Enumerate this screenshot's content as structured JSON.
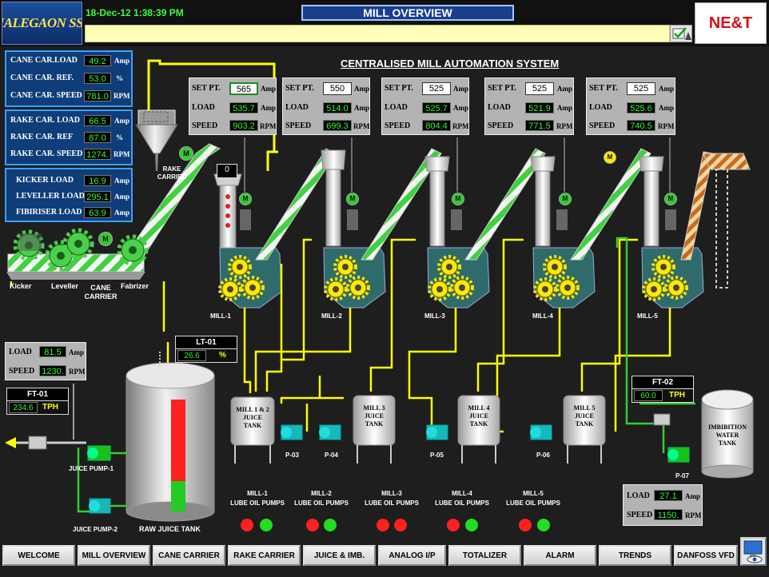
{
  "header": {
    "logo_text": "MALEGAON SSK",
    "datetime": "18-Dec-12 1:38:39 PM",
    "screen_title": "MILL OVERVIEW",
    "brand": "NE&T",
    "system_title": "CENTRALISED MILL AUTOMATION SYSTEM"
  },
  "cane_carrier_panel": [
    {
      "label": "CANE CAR.LOAD",
      "value": "49.2",
      "unit": "Amp"
    },
    {
      "label": "CANE CAR. REF.",
      "value": "53.0",
      "unit": "%"
    },
    {
      "label": "CANE CAR. SPEED",
      "value": "781.0",
      "unit": "RPM"
    }
  ],
  "rake_carrier_panel": [
    {
      "label": "RAKE CAR. LOAD",
      "value": "66.5",
      "unit": "Amp"
    },
    {
      "label": "RAKE CAR. REF",
      "value": "87.0",
      "unit": "%"
    },
    {
      "label": "RAKE CAR. SPEED",
      "value": "1274.",
      "unit": "RPM"
    }
  ],
  "preparatory_panel": [
    {
      "label": "KICKER LOAD",
      "value": "16.9",
      "unit": "Amp"
    },
    {
      "label": "LEVELLER LOAD",
      "value": "295.1",
      "unit": "Amp"
    },
    {
      "label": "FIBIRISER LOAD",
      "value": "63.9",
      "unit": "Amp"
    }
  ],
  "mill_panel_labels": {
    "set_pt": "SET PT.",
    "load": "LOAD",
    "speed": "SPEED",
    "amp": "Amp",
    "rpm": "RPM"
  },
  "mills": [
    {
      "name": "MILL-1",
      "set_pt": "565",
      "load": "535.7",
      "speed": "903.2"
    },
    {
      "name": "MILL-2",
      "set_pt": "550",
      "load": "514.0",
      "speed": "699.3"
    },
    {
      "name": "MILL-3",
      "set_pt": "525",
      "load": "525.7",
      "speed": "804.4"
    },
    {
      "name": "MILL-4",
      "set_pt": "525",
      "load": "521.9",
      "speed": "771.5"
    },
    {
      "name": "MILL-5",
      "set_pt": "525",
      "load": "525.6",
      "speed": "740.5"
    }
  ],
  "rake_carrier_label": "RAKE CARRIER",
  "chute_level": "0",
  "prep_labels": {
    "kicker": "Kicker",
    "leveller": "Leveller",
    "cane_carrier": "CANE CARRIER",
    "fabrizer": "Fabrizer"
  },
  "motor_label": "M",
  "juice_pump_panel": {
    "load_label": "LOAD",
    "load": "81.5",
    "load_unit": "Amp",
    "speed_label": "SPEED",
    "speed": "1230.",
    "speed_unit": "RPM"
  },
  "ft01": {
    "name": "FT-01",
    "value": "234.6",
    "unit": "TPH"
  },
  "lt01": {
    "name": "LT-01",
    "value": "26.6",
    "unit": "%"
  },
  "ft02": {
    "name": "FT-02",
    "value": "60.0",
    "unit": "TPH"
  },
  "imbibition_panel": {
    "load_label": "LOAD",
    "load": "27.1",
    "load_unit": "Amp",
    "speed_label": "SPEED",
    "speed": "1150.",
    "speed_unit": "RPM"
  },
  "juice_tanks": [
    "MILL 1 & 2\nJUICE\nTANK",
    "MILL 3\nJUICE\nTANK",
    "MILL 4\nJUICE\nTANK",
    "MILL 5\nJUICE\nTANK"
  ],
  "imbibition_tank": "IMBIBITION\nWATER\nTANK",
  "raw_juice_tank": "RAW JUICE TANK",
  "pumps": [
    "JUICE PUMP-1",
    "JUICE PUMP-2",
    "P-03",
    "P-04",
    "P-05",
    "P-06",
    "P-07"
  ],
  "lube_pumps": [
    {
      "line1": "MILL-1",
      "line2": "LUBE OIL PUMPS"
    },
    {
      "line1": "MILL-2",
      "line2": "LUBE OIL PUMPS"
    },
    {
      "line1": "MILL-3",
      "line2": "LUBE OIL PUMPS"
    },
    {
      "line1": "MILL-4",
      "line2": "LUBE OIL PUMPS"
    },
    {
      "line1": "MILL-5",
      "line2": "LUBE OIL PUMPS"
    }
  ],
  "nav": [
    "WELCOME",
    "MILL OVERVIEW",
    "CANE CARRIER",
    "RAKE CARRIER",
    "JUICE & IMB.",
    "ANALOG I/P",
    "TOTALIZER",
    "ALARM",
    "TRENDS",
    "DANFOSS VFD"
  ],
  "colors": {
    "background": "#1e1e1e",
    "value_text": "#2cff2c",
    "pipe_juice": "#ffff00",
    "pipe_water": "#33cc33",
    "mill_body": "#2f6b6b",
    "panel_blue": "#0e3d79"
  }
}
